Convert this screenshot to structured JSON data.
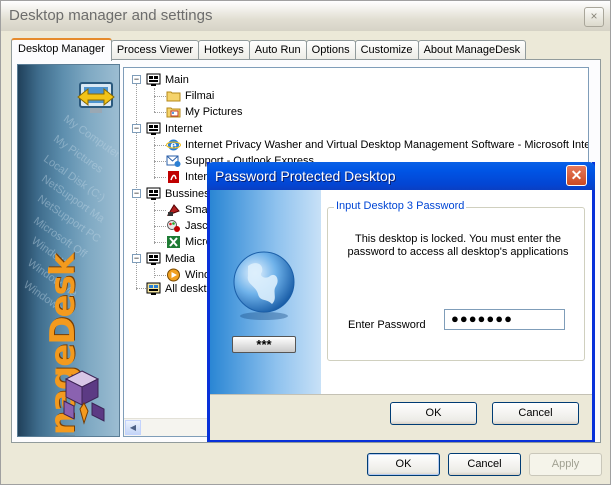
{
  "window": {
    "title": "Desktop manager and settings",
    "close_glyph": "×"
  },
  "tabs": [
    {
      "label": "Desktop Manager",
      "active": true
    },
    {
      "label": "Process Viewer"
    },
    {
      "label": "Hotkeys"
    },
    {
      "label": "Auto Run"
    },
    {
      "label": "Options"
    },
    {
      "label": "Customize"
    },
    {
      "label": "About ManageDesk"
    }
  ],
  "banner": {
    "brand": "ManageDesk",
    "ghost_items": [
      "My Computer",
      "My Pictures",
      "Local Disk (C:)",
      "NetSupport Ma",
      "NetSupport PC",
      "Microsoft Off",
      "Windows",
      "Window Me",
      "Windows"
    ]
  },
  "tree": {
    "nodes": [
      {
        "label": "Main",
        "icon": "desktop-icon"
      },
      {
        "label": "Filmai",
        "icon": "folder-icon"
      },
      {
        "label": "My Pictures",
        "icon": "pictures-icon"
      },
      {
        "label": "Internet",
        "icon": "desktop-icon"
      },
      {
        "label": "Internet Privacy Washer and Virtual Desktop Management Software - Microsoft Intern",
        "icon": "ie-icon"
      },
      {
        "label": "Support - Outlook Express",
        "icon": "outlook-icon"
      },
      {
        "label": "Intern",
        "icon": "acrobat-icon"
      },
      {
        "label": "Bussines",
        "icon": "desktop-icon"
      },
      {
        "label": "Smar",
        "icon": "app-icon"
      },
      {
        "label": "Jasc",
        "icon": "paint-icon"
      },
      {
        "label": "Micro",
        "icon": "excel-icon"
      },
      {
        "label": "Media",
        "icon": "desktop-icon"
      },
      {
        "label": "Wind",
        "icon": "media-player-icon"
      },
      {
        "label": "All deskto",
        "icon": "desktop-icon"
      }
    ],
    "expander_minus": "−"
  },
  "buttons": {
    "ok": "OK",
    "cancel": "Cancel",
    "apply": "Apply"
  },
  "dialog": {
    "title": "Password Protected Desktop",
    "close_glyph": "✕",
    "group_label": "Input Desktop 3 Password",
    "message": "This desktop is locked. You must enter the password to access all desktop's applications",
    "password_label": "Enter Password",
    "password_value": "●●●●●●●",
    "badge_text": "***",
    "ok": "OK",
    "cancel": "Cancel"
  },
  "colors": {
    "accent_tab": "#e68b2c",
    "dialog_title": "#0055e5",
    "brand_orange": "#f39a1e"
  }
}
